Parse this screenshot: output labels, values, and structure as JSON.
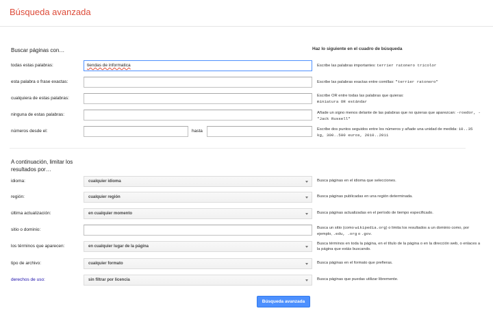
{
  "header": {
    "title": "Búsqueda avanzada"
  },
  "find": {
    "heading": "Buscar páginas con…",
    "hint_heading": "Haz lo siguiente en el cuadro de búsqueda",
    "all_words": {
      "label": "todas estas palabras:",
      "value": "tiendas de informatica",
      "hint_text": "Escribe las palabras importantes: ",
      "hint_code": "terrier ratonero tricolor"
    },
    "exact_phrase": {
      "label": "esta palabra o frase exactas:",
      "value": "",
      "hint_text": "Escribe las palabras exactas entre comillas: ",
      "hint_code": "\"terrier ratonero\""
    },
    "any_words": {
      "label": "cualquiera de estas palabras:",
      "value": "",
      "hint_text": "Escribe OR entre todas las palabras que quieras:",
      "hint_code": "miniatura OR estándar"
    },
    "none_words": {
      "label": "ninguna de estas palabras:",
      "value": "",
      "hint_text": "Añade un signo menos delante de las palabras que no quieras que aparezcan: ",
      "hint_code": "-roedor, -\"Jack Russell\""
    },
    "numbers": {
      "label": "números desde el:",
      "from_value": "",
      "to_label": "hasta",
      "to_value": "",
      "hint_text": "Escribe dos puntos seguidos entre los números y añade una unidad de medida: ",
      "hint_code": "10..35 kg, 300..500 euros, 2010..2011"
    }
  },
  "narrow": {
    "heading": "A continuación, limitar los resultados por…",
    "language": {
      "label": "idioma:",
      "value": "cualquier idioma",
      "hint": "Busca páginas en el idioma que selecciones."
    },
    "region": {
      "label": "región:",
      "value": "cualquier región",
      "hint": "Busca páginas publicadas en una región determinada."
    },
    "last_update": {
      "label": "última actualización:",
      "value": "en cualquier momento",
      "hint": "Busca páginas actualizadas en el período de tiempo especificado."
    },
    "site": {
      "label": "sitio o dominio:",
      "value": "",
      "hint_a": "Busca un sitio (como ",
      "hint_code1": "wikipedia.org",
      "hint_b": ") o limita los resultados a un dominio como, por ejemplo, ",
      "hint_code2": ".edu, .org",
      "hint_c": " o ",
      "hint_code3": ".gov",
      "hint_d": "."
    },
    "terms_appearing": {
      "label": "los términos que aparecen:",
      "value": "en cualquier lugar de la página",
      "hint": "Busca términos en toda la página, en el título de la página o en la dirección web, o enlaces a la página que estás buscando."
    },
    "file_type": {
      "label": "tipo de archivo:",
      "value": "cualquier formato",
      "hint": "Busca páginas en el formato que prefieras."
    },
    "usage_rights": {
      "label": "derechos de uso:",
      "value": "sin filtrar por licencia",
      "hint": "Busca páginas que puedas utilizar libremente."
    }
  },
  "submit_label": "Búsqueda avanzada",
  "colors": {
    "brand_red": "#dd4b39",
    "button_blue": "#4d90fe",
    "link_blue": "#1a0dab"
  }
}
